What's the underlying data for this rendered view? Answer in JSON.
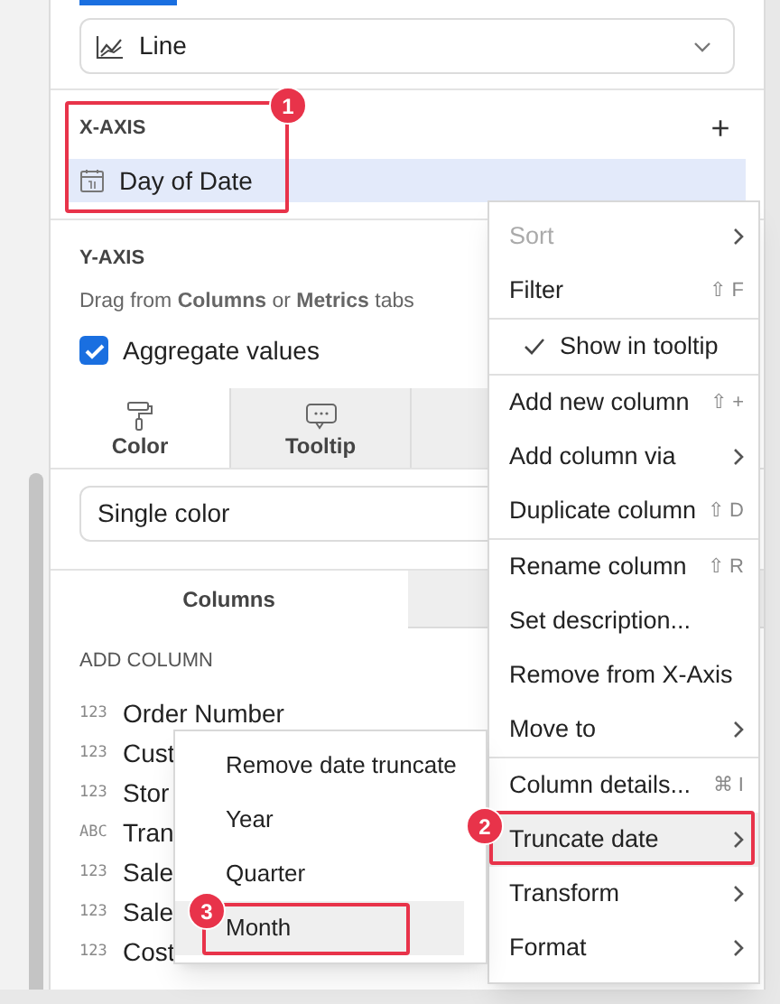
{
  "chart_type": {
    "value": "Line"
  },
  "x_axis": {
    "title": "X-AXIS",
    "add": "+",
    "items": [
      {
        "label": "Day of Date",
        "selected": true
      }
    ]
  },
  "y_axis": {
    "title": "Y-AXIS",
    "hint": "Drag from **Columns** or **Metrics** tabs",
    "aggregate": {
      "label": "Aggregate values",
      "checked": true
    }
  },
  "marks_tabs": [
    {
      "label": "Color",
      "selected": true
    },
    {
      "label": "Tooltip",
      "selected": false
    },
    {
      "selected": false
    }
  ],
  "color_field": {
    "value": "Single color"
  },
  "source_tabs": [
    {
      "label": "Columns",
      "selected": true
    },
    {
      "selected": false
    }
  ],
  "add_column": {
    "title": "ADD COLUMN",
    "columns": [
      {
        "type": "123",
        "name": "Order Number"
      },
      {
        "type": "123",
        "name": "Cust"
      },
      {
        "type": "123",
        "name": "Stor"
      },
      {
        "type": "ABC",
        "name": "Tran"
      },
      {
        "type": "123",
        "name": "Sale"
      },
      {
        "type": "123",
        "name": "Sale"
      },
      {
        "type": "123",
        "name": "Cost"
      }
    ]
  },
  "context_menu": [
    {
      "kind": "item",
      "label": "Sort",
      "disabled": true,
      "has_submenu": true,
      "highlighted": false
    },
    {
      "kind": "item",
      "label": "Filter",
      "shortcut": "⇧ F",
      "disabled": false,
      "has_submenu": false,
      "highlighted": false
    },
    {
      "kind": "divider"
    },
    {
      "kind": "check",
      "label": "Show in tooltip",
      "checked": true,
      "disabled": false,
      "has_submenu": false,
      "highlighted": false
    },
    {
      "kind": "divider"
    },
    {
      "kind": "item",
      "label": "Add new column",
      "shortcut": "⇧ +",
      "disabled": false,
      "has_submenu": false,
      "highlighted": false
    },
    {
      "kind": "item",
      "label": "Add column via",
      "disabled": false,
      "has_submenu": true,
      "highlighted": false
    },
    {
      "kind": "item",
      "label": "Duplicate column",
      "shortcut": "⇧ D",
      "disabled": false,
      "has_submenu": false,
      "highlighted": false
    },
    {
      "kind": "divider"
    },
    {
      "kind": "item",
      "label": "Rename column",
      "shortcut": "⇧ R",
      "disabled": false,
      "has_submenu": false,
      "highlighted": false
    },
    {
      "kind": "item",
      "label": "Set description...",
      "disabled": false,
      "has_submenu": false,
      "highlighted": false
    },
    {
      "kind": "item",
      "label": "Remove from X-Axis",
      "disabled": false,
      "has_submenu": false,
      "highlighted": false
    },
    {
      "kind": "item",
      "label": "Move to",
      "disabled": false,
      "has_submenu": true,
      "highlighted": false
    },
    {
      "kind": "divider"
    },
    {
      "kind": "item",
      "label": "Column details...",
      "shortcut": "⌘ I",
      "disabled": false,
      "has_submenu": false,
      "highlighted": false
    },
    {
      "kind": "item",
      "label": "Truncate date",
      "disabled": false,
      "has_submenu": true,
      "highlighted": true
    },
    {
      "kind": "item",
      "label": "Transform",
      "disabled": false,
      "has_submenu": true,
      "highlighted": false
    },
    {
      "kind": "item",
      "label": "Format",
      "disabled": false,
      "has_submenu": true,
      "highlighted": false
    }
  ],
  "truncate_submenu": [
    {
      "label": "Remove date truncate",
      "highlighted": false
    },
    {
      "label": "Year",
      "highlighted": false
    },
    {
      "label": "Quarter",
      "highlighted": false
    },
    {
      "label": "Month",
      "highlighted": true
    }
  ],
  "annotations": [
    {
      "number": "1"
    },
    {
      "number": "2"
    },
    {
      "number": "3"
    }
  ]
}
